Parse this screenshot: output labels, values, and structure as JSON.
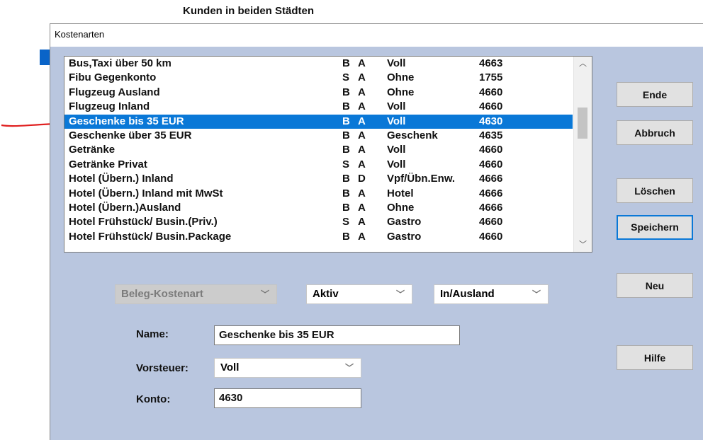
{
  "background_title": "Kunden in beiden Städten",
  "window": {
    "title": "Kostenarten"
  },
  "list": {
    "selected_index": 4,
    "rows": [
      {
        "name": "Bus,Taxi über 50 km",
        "t": "B",
        "s": "A",
        "v": "Voll",
        "k": "4663"
      },
      {
        "name": "Fibu Gegenkonto",
        "t": "S",
        "s": "A",
        "v": "Ohne",
        "k": "1755"
      },
      {
        "name": "Flugzeug Ausland",
        "t": "B",
        "s": "A",
        "v": "Ohne",
        "k": "4660"
      },
      {
        "name": "Flugzeug Inland",
        "t": "B",
        "s": "A",
        "v": "Voll",
        "k": "4660"
      },
      {
        "name": "Geschenke bis 35 EUR",
        "t": "B",
        "s": "A",
        "v": "Voll",
        "k": "4630"
      },
      {
        "name": "Geschenke über 35 EUR",
        "t": "B",
        "s": "A",
        "v": "Geschenk",
        "k": "4635"
      },
      {
        "name": "Getränke",
        "t": "B",
        "s": "A",
        "v": "Voll",
        "k": "4660"
      },
      {
        "name": "Getränke Privat",
        "t": "S",
        "s": "A",
        "v": "Voll",
        "k": "4660"
      },
      {
        "name": "Hotel (Übern.) Inland",
        "t": "B",
        "s": "D",
        "v": "Vpf/Übn.Enw.",
        "k": "4666"
      },
      {
        "name": "Hotel (Übern.) Inland mit MwSt",
        "t": "B",
        "s": "A",
        "v": "Hotel",
        "k": "4666"
      },
      {
        "name": "Hotel (Übern.)Ausland",
        "t": "B",
        "s": "A",
        "v": "Ohne",
        "k": "4666"
      },
      {
        "name": "Hotel Frühstück/ Busin.(Priv.)",
        "t": "S",
        "s": "A",
        "v": "Gastro",
        "k": "4660"
      },
      {
        "name": "Hotel Frühstück/ Busin.Package",
        "t": "B",
        "s": "A",
        "v": "Gastro",
        "k": "4660"
      }
    ]
  },
  "buttons": {
    "ende": "Ende",
    "abbruch": "Abbruch",
    "loeschen": "Löschen",
    "speichern": "Speichern",
    "neu": "Neu",
    "hilfe": "Hilfe"
  },
  "filters": {
    "belegart": "Beleg-Kostenart",
    "status": "Aktiv",
    "region": "In/Ausland"
  },
  "form": {
    "name_label": "Name:",
    "name_value": "Geschenke bis 35 EUR",
    "vorsteuer_label": "Vorsteuer:",
    "vorsteuer_value": "Voll",
    "konto_label": "Konto:",
    "konto_value": "4630"
  },
  "colors": {
    "client_bg": "#b9c6df",
    "selection": "#0a78d7",
    "annotation_arrow": "#e02020"
  },
  "icons": {
    "scroll_up": "▲",
    "scroll_down": "▼",
    "dropdown": "⌄"
  }
}
